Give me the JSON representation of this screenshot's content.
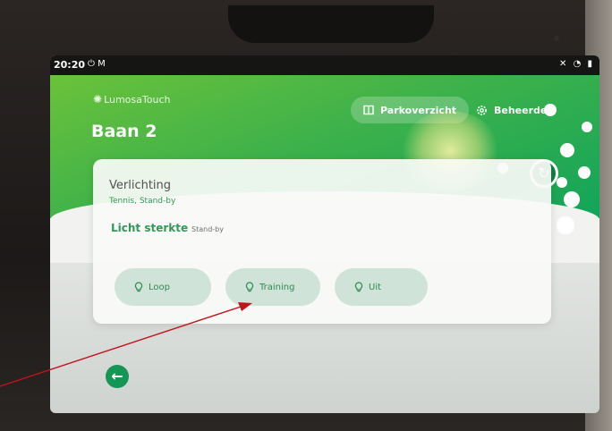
{
  "status_bar": {
    "time": "20:20",
    "left_icons": "⏻ M",
    "right_icons": "✕ ◔ ▮"
  },
  "header": {
    "logo_text": "LumosaTouch",
    "page_title": "Baan 2",
    "nav_park_label": "Parkoverzicht",
    "nav_admin_label": "Beheerder"
  },
  "card": {
    "title": "Verlichting",
    "subtitle": "Tennis, Stand-by",
    "light_strength_label": "Licht sterkte",
    "light_strength_value": "Stand-by",
    "modes": [
      {
        "label": "Loop"
      },
      {
        "label": "Training"
      },
      {
        "label": "Uit"
      }
    ]
  },
  "colors": {
    "brand_green": "#3fb24a",
    "dark_green": "#0f7e44",
    "text_green": "#2f9a58",
    "button_bg": "#cfe3d8",
    "annotation_arrow": "#c0141c"
  },
  "icons": {
    "logo": "lumosa-sun-icon",
    "park": "book-icon",
    "admin": "gear-icon",
    "refresh": "refresh-icon",
    "mode": "lightbulb-icon",
    "back": "arrow-left-icon"
  }
}
